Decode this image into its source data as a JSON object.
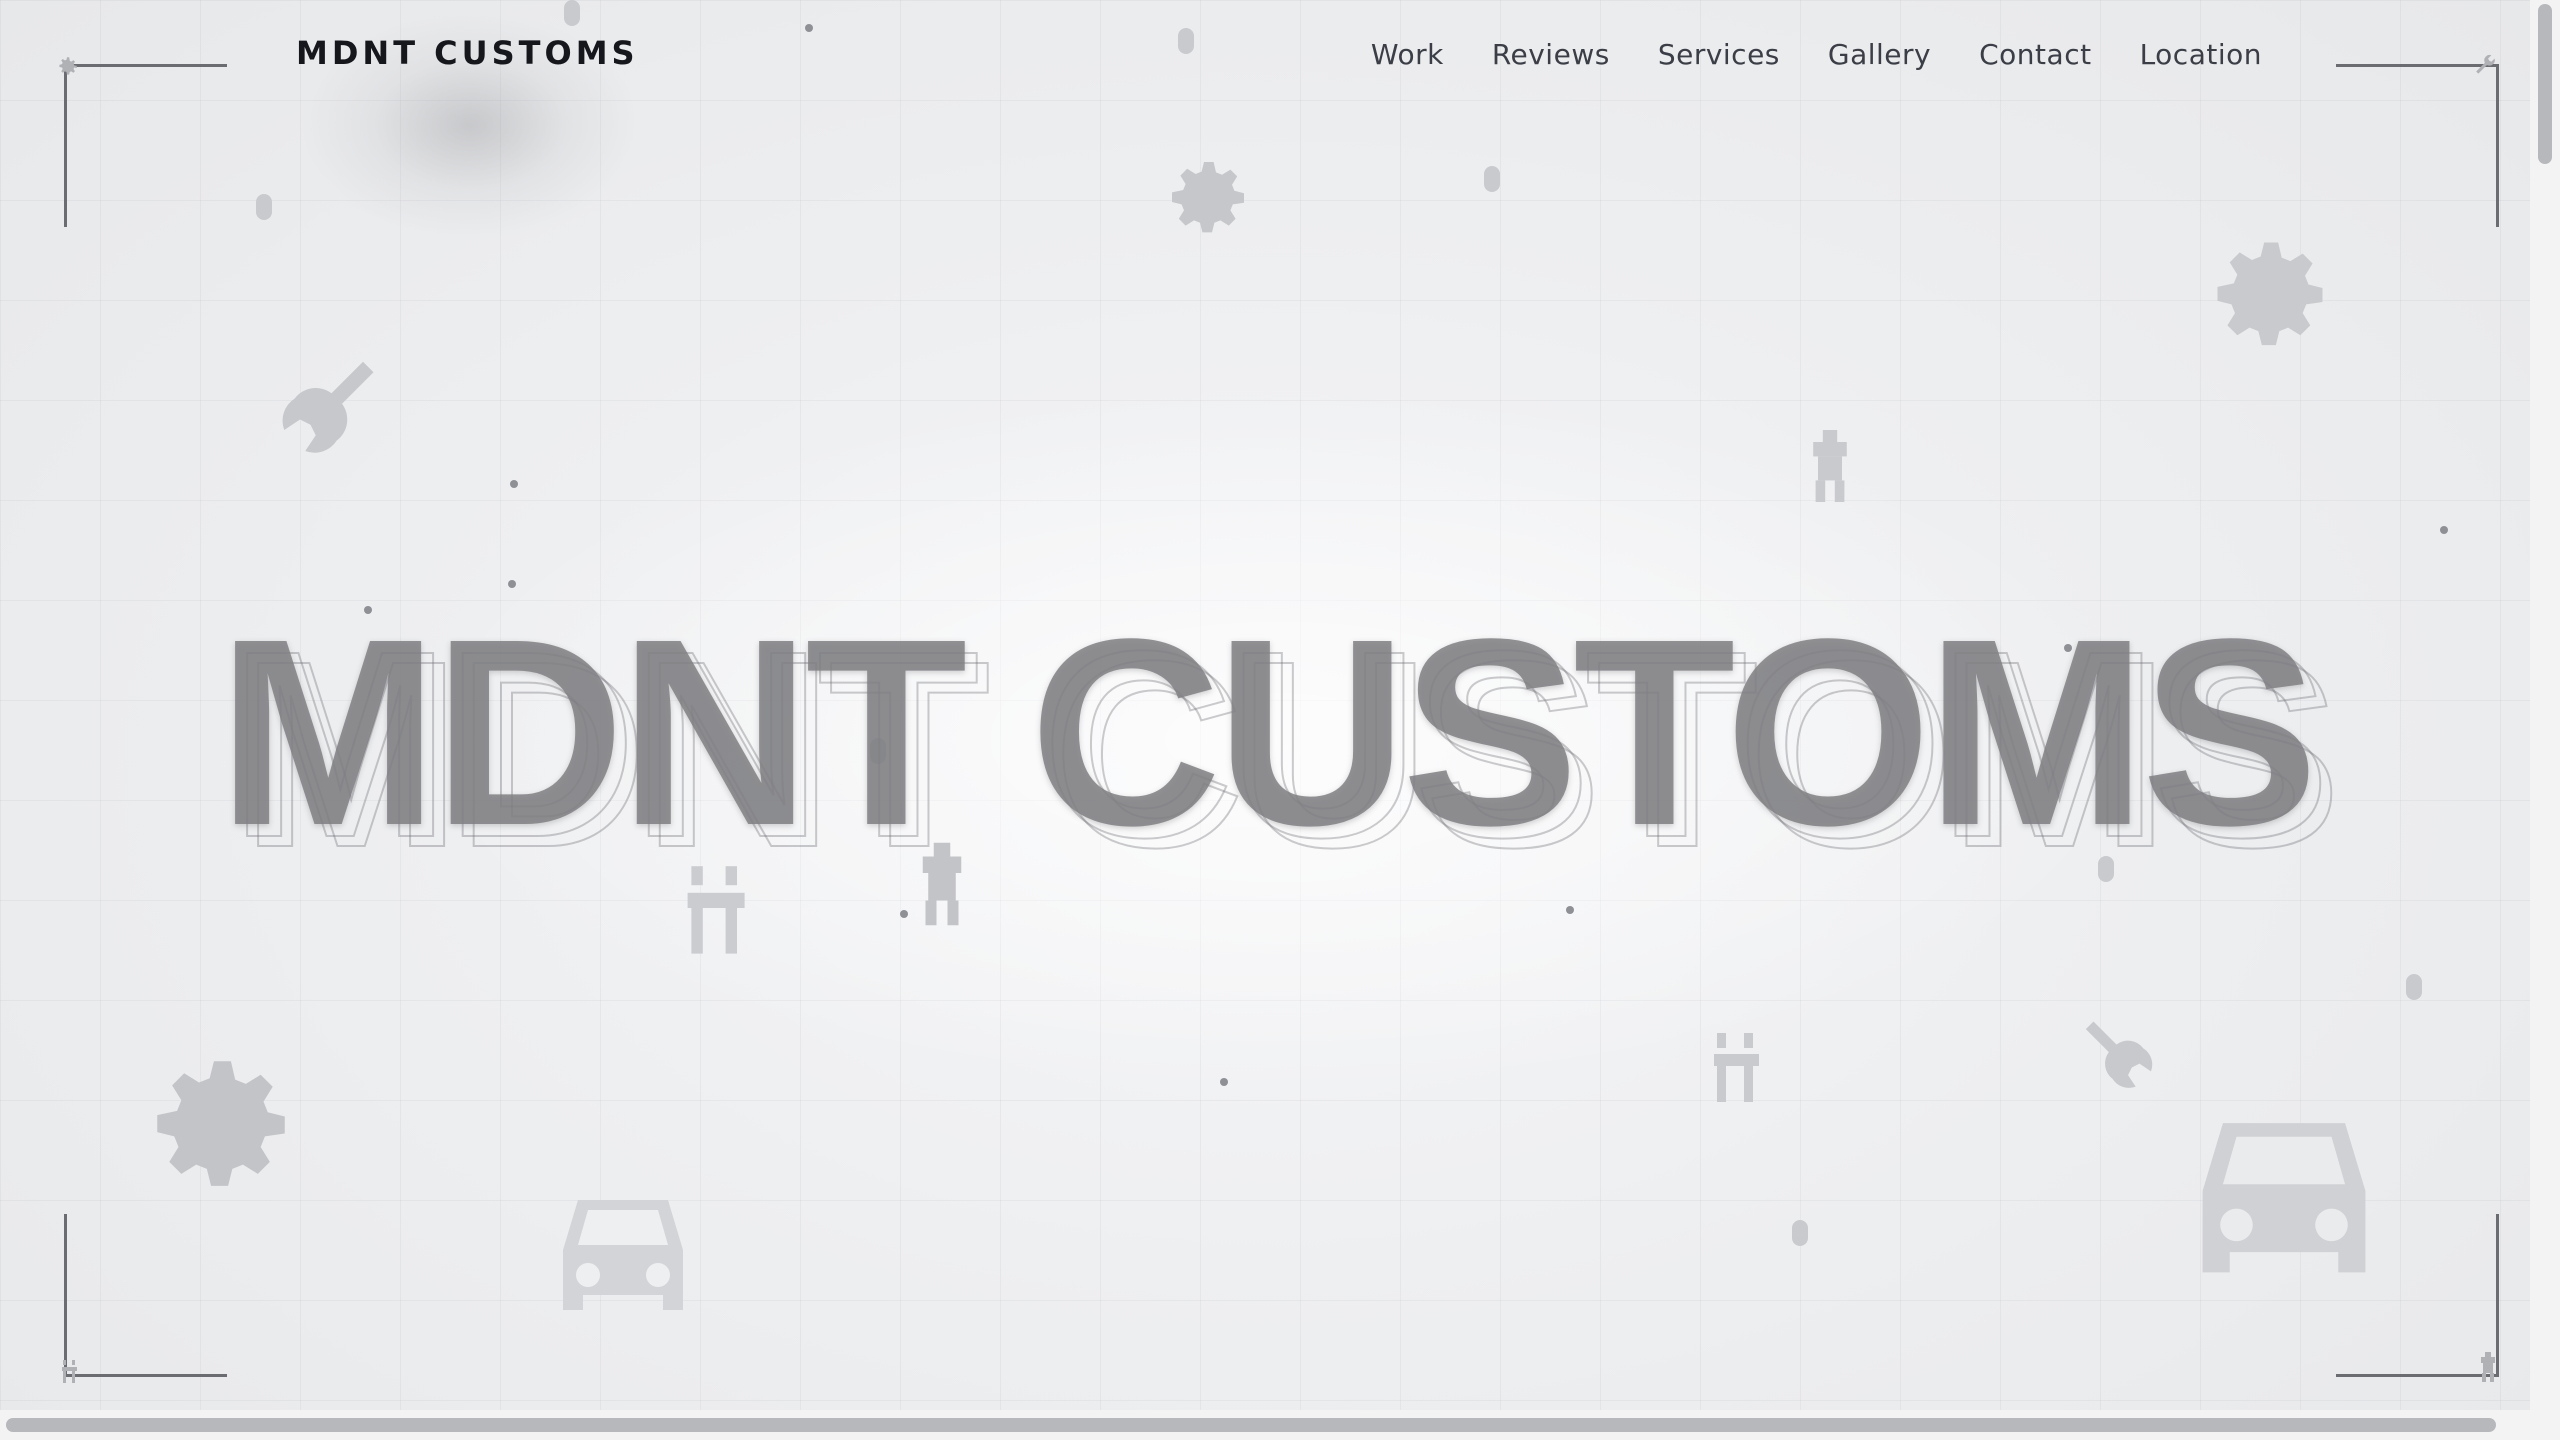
{
  "header": {
    "brand": "MDNT CUSTOMS",
    "nav": [
      {
        "label": "Work"
      },
      {
        "label": "Reviews"
      },
      {
        "label": "Services"
      },
      {
        "label": "Gallery"
      },
      {
        "label": "Contact"
      },
      {
        "label": "Location"
      }
    ]
  },
  "hero": {
    "title": "MDNT CUSTOMS"
  },
  "decor": {
    "icons": [
      "gear-icon",
      "wrench-icon",
      "car-icon",
      "spark-plug-icon",
      "ev-charger-icon"
    ]
  },
  "colors": {
    "background": "#eeeff1",
    "brand_text": "#15171c",
    "nav_text": "#3b3e46",
    "hero_fill": "#808084",
    "corner_bracket": "#6a6c72"
  }
}
